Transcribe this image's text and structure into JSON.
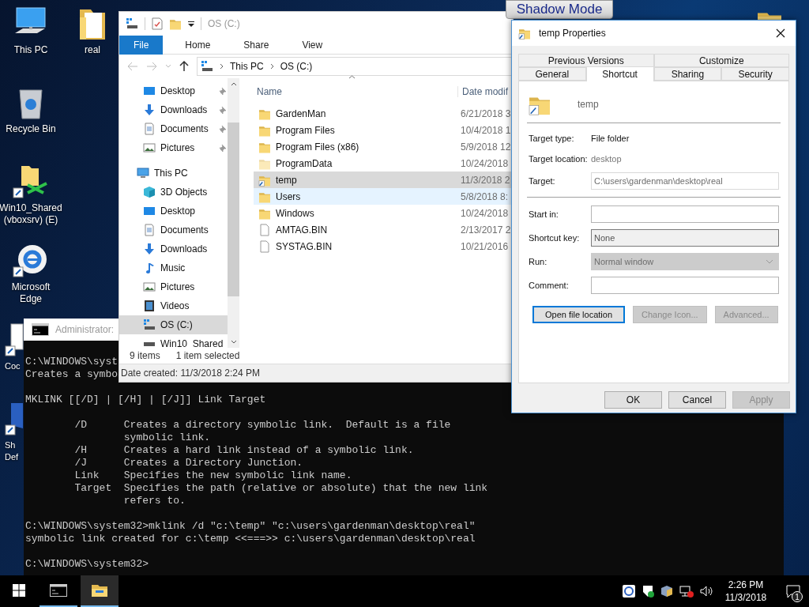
{
  "desktop": {
    "icons": [
      {
        "kind": "computer",
        "label": [
          "This PC"
        ]
      },
      {
        "kind": "recycle-bin",
        "label": [
          "Recycle Bin"
        ]
      },
      {
        "kind": "shared-folder",
        "label": [
          "Win10_Shared",
          "(vboxsrv) (E)"
        ]
      },
      {
        "kind": "edge",
        "label": [
          "Microsoft",
          "Edge"
        ]
      },
      {
        "kind": "document",
        "label": [
          "Coc"
        ]
      },
      {
        "kind": "shield",
        "label": [
          "Sh",
          "Def"
        ]
      }
    ],
    "icons_second_column": [
      {
        "kind": "folder",
        "label": [
          "real"
        ]
      }
    ],
    "overlay_button": "Shadow Mode"
  },
  "explorer": {
    "title": "OS (C:)",
    "ribbon_tabs": [
      {
        "label": "File",
        "selected": true
      },
      {
        "label": "Home",
        "selected": false
      },
      {
        "label": "Share",
        "selected": false
      },
      {
        "label": "View",
        "selected": false
      }
    ],
    "breadcrumb": [
      "This PC",
      "OS (C:)"
    ],
    "nav": {
      "quick_access": [
        {
          "label": "Desktop",
          "kind": "desktop",
          "pinned": true
        },
        {
          "label": "Downloads",
          "kind": "download",
          "pinned": true
        },
        {
          "label": "Documents",
          "kind": "document",
          "pinned": true
        },
        {
          "label": "Pictures",
          "kind": "picture",
          "pinned": true
        }
      ],
      "this_pc": {
        "label": "This PC",
        "children": [
          {
            "label": "3D Objects",
            "kind": "cube",
            "selected": false
          },
          {
            "label": "Desktop",
            "kind": "desktop",
            "selected": false
          },
          {
            "label": "Documents",
            "kind": "document",
            "selected": false
          },
          {
            "label": "Downloads",
            "kind": "download",
            "selected": false
          },
          {
            "label": "Music",
            "kind": "music",
            "selected": false
          },
          {
            "label": "Pictures",
            "kind": "picture",
            "selected": false
          },
          {
            "label": "Videos",
            "kind": "video",
            "selected": false
          },
          {
            "label": "OS (C:)",
            "kind": "drive",
            "selected": true
          },
          {
            "label": "Win10_Shared",
            "kind": "net-drive",
            "selected": false
          }
        ]
      }
    },
    "columns": [
      "Name",
      "Date modif"
    ],
    "rows": [
      {
        "name": "GardenMan",
        "date": "6/21/2018 3",
        "kind": "folder",
        "selected": false,
        "hovered": false
      },
      {
        "name": "Program Files",
        "date": "10/4/2018 1",
        "kind": "folder",
        "selected": false,
        "hovered": false
      },
      {
        "name": "Program Files (x86)",
        "date": "5/9/2018 12",
        "kind": "folder",
        "selected": false,
        "hovered": false
      },
      {
        "name": "ProgramData",
        "date": "10/24/2018",
        "kind": "hidden-folder",
        "selected": false,
        "hovered": false
      },
      {
        "name": "temp",
        "date": "11/3/2018 2",
        "kind": "link-folder",
        "selected": true,
        "hovered": false
      },
      {
        "name": "Users",
        "date": "5/8/2018 8:",
        "kind": "folder",
        "selected": false,
        "hovered": true
      },
      {
        "name": "Windows",
        "date": "10/24/2018",
        "kind": "folder",
        "selected": false,
        "hovered": false
      },
      {
        "name": "AMTAG.BIN",
        "date": "2/13/2017 2",
        "kind": "file",
        "selected": false,
        "hovered": false
      },
      {
        "name": "SYSTAG.BIN",
        "date": "10/21/2016",
        "kind": "file",
        "selected": false,
        "hovered": false
      }
    ],
    "status": [
      "9 items",
      "1 item selected"
    ],
    "details": "Date created: 11/3/2018 2:24 PM"
  },
  "console": {
    "title": "Administrator:",
    "blocks": [
      [
        "C:\\WINDOWS\\syst",
        "Creates a symbo"
      ],
      [
        "MKLINK [[/D] | [/H] | [/J]] Link Target"
      ],
      [
        "        /D      Creates a directory symbolic link.  Default is a file",
        "                symbolic link.",
        "        /H      Creates a hard link instead of a symbolic link.",
        "        /J      Creates a Directory Junction.",
        "        Link    Specifies the new symbolic link name.",
        "        Target  Specifies the path (relative or absolute) that the new link",
        "                refers to."
      ],
      [
        "C:\\WINDOWS\\system32>mklink /d \"c:\\temp\" \"c:\\users\\gardenman\\desktop\\real\"",
        "symbolic link created for c:\\temp <<===>> c:\\users\\gardenman\\desktop\\real"
      ],
      [
        "C:\\WINDOWS\\system32>"
      ]
    ]
  },
  "properties": {
    "title": "temp Properties",
    "tabs_row1": [
      {
        "label": "Previous Versions",
        "selected": false
      },
      {
        "label": "Customize",
        "selected": false
      }
    ],
    "tabs_row2": [
      {
        "label": "General",
        "selected": false
      },
      {
        "label": "Shortcut",
        "selected": true
      },
      {
        "label": "Sharing",
        "selected": false
      },
      {
        "label": "Security",
        "selected": false
      }
    ],
    "name": "temp",
    "sections": [
      [
        {
          "label": "Target type:",
          "kind": "text",
          "value": "File folder",
          "disabled": false
        },
        {
          "label": "Target location:",
          "kind": "text",
          "value": "desktop",
          "disabled": true
        },
        {
          "label": "Target:",
          "kind": "input",
          "value": "C:\\users\\gardenman\\desktop\\real",
          "disabled": true
        }
      ],
      [
        {
          "label": "Start in:",
          "kind": "input",
          "disabled": false
        },
        {
          "label": "Shortcut key:",
          "kind": "hotkey",
          "value": "None",
          "disabled": false
        },
        {
          "label": "Run:",
          "kind": "dropdown",
          "value": "Normal window",
          "disabled": true
        },
        {
          "label": "Comment:",
          "kind": "input",
          "disabled": false
        }
      ]
    ],
    "actions": [
      {
        "label": "Open file location",
        "disabled": false,
        "focused": true
      },
      {
        "label": "Change Icon...",
        "disabled": true,
        "focused": false
      },
      {
        "label": "Advanced...",
        "disabled": true,
        "focused": false
      }
    ],
    "buttons": [
      {
        "label": "OK",
        "disabled": false
      },
      {
        "label": "Cancel",
        "disabled": false
      },
      {
        "label": "Apply",
        "disabled": true
      }
    ]
  },
  "taskbar": {
    "apps": [
      {
        "kind": "console",
        "selected": false
      },
      {
        "kind": "explorer",
        "selected": true
      }
    ],
    "time": "2:26 PM",
    "date": "11/3/2018",
    "notifications": "1"
  }
}
